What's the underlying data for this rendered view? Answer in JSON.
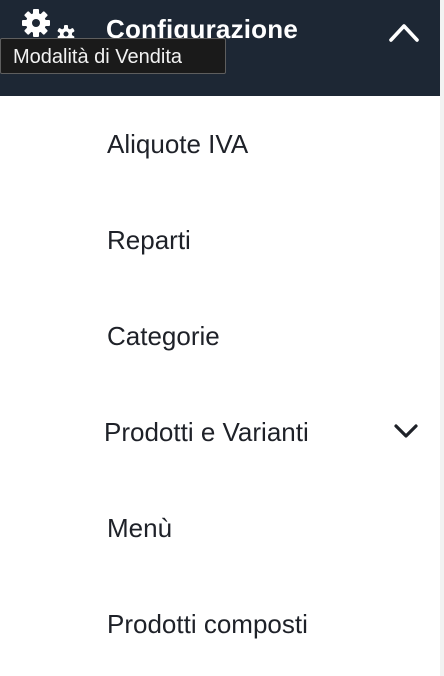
{
  "header": {
    "title": "Configurazione",
    "icon": "gear-icon",
    "collapse_icon": "chevron-up-icon",
    "background": "#1d2734"
  },
  "tooltip": {
    "text": "Modalità di Vendita"
  },
  "menu": {
    "items": [
      {
        "label": "Aliquote IVA"
      },
      {
        "label": "Reparti"
      },
      {
        "label": "Categorie"
      },
      {
        "label": "Prodotti e Varianti",
        "icon": "chevron-down-icon"
      },
      {
        "label": "Menù"
      },
      {
        "label": "Prodotti composti"
      }
    ]
  }
}
